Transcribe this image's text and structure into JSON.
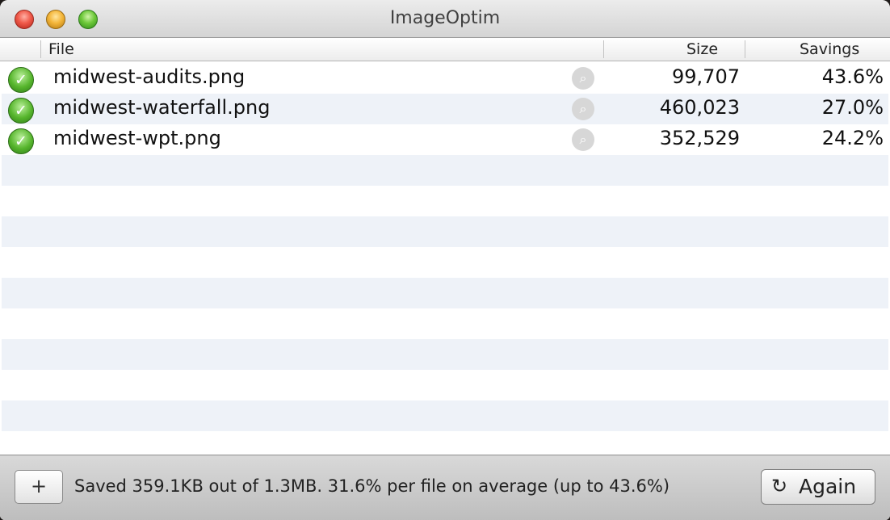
{
  "window": {
    "title": "ImageOptim"
  },
  "columns": {
    "file": "File",
    "size": "Size",
    "savings": "Savings"
  },
  "files": [
    {
      "name": "midwest-audits.png",
      "size": "99,707",
      "savings": "43.6%",
      "status": "check-icon"
    },
    {
      "name": "midwest-waterfall.png",
      "size": "460,023",
      "savings": "27.0%",
      "status": "check-icon"
    },
    {
      "name": "midwest-wpt.png",
      "size": "352,529",
      "savings": "24.2%",
      "status": "check-icon"
    }
  ],
  "footer": {
    "add_label": "+",
    "summary": "Saved 359.1KB out of 1.3MB. 31.6% per file on average (up to 43.6%)",
    "again_label": "Again",
    "again_icon": "reload-icon"
  },
  "colors": {
    "row_alt": "#eef2f8",
    "status_green": "#56b52c"
  }
}
